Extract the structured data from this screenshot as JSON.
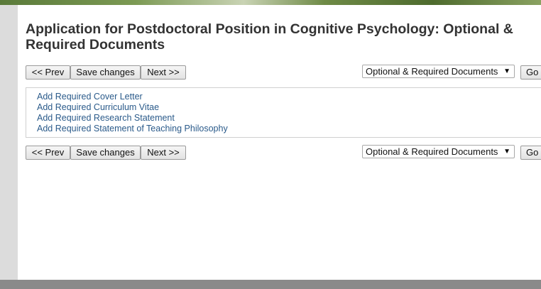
{
  "page": {
    "title": "Application for Postdoctoral Position in Cognitive Psychology: Optional & Required Documents"
  },
  "nav": {
    "prev_label": "<< Prev",
    "save_label": "Save changes",
    "next_label": "Next >>",
    "section_selected": "Optional & Required Documents",
    "go_label": "Go"
  },
  "documents": {
    "links": [
      "Add Required Cover Letter",
      "Add Required Curriculum Vitae",
      "Add Required Research Statement",
      "Add Required Statement of Teaching Philosophy"
    ]
  },
  "colors": {
    "link": "#2a5a8a",
    "title": "#333333",
    "left_bar": "#dcdcdc",
    "bottom_bar": "#8a8a8a"
  }
}
